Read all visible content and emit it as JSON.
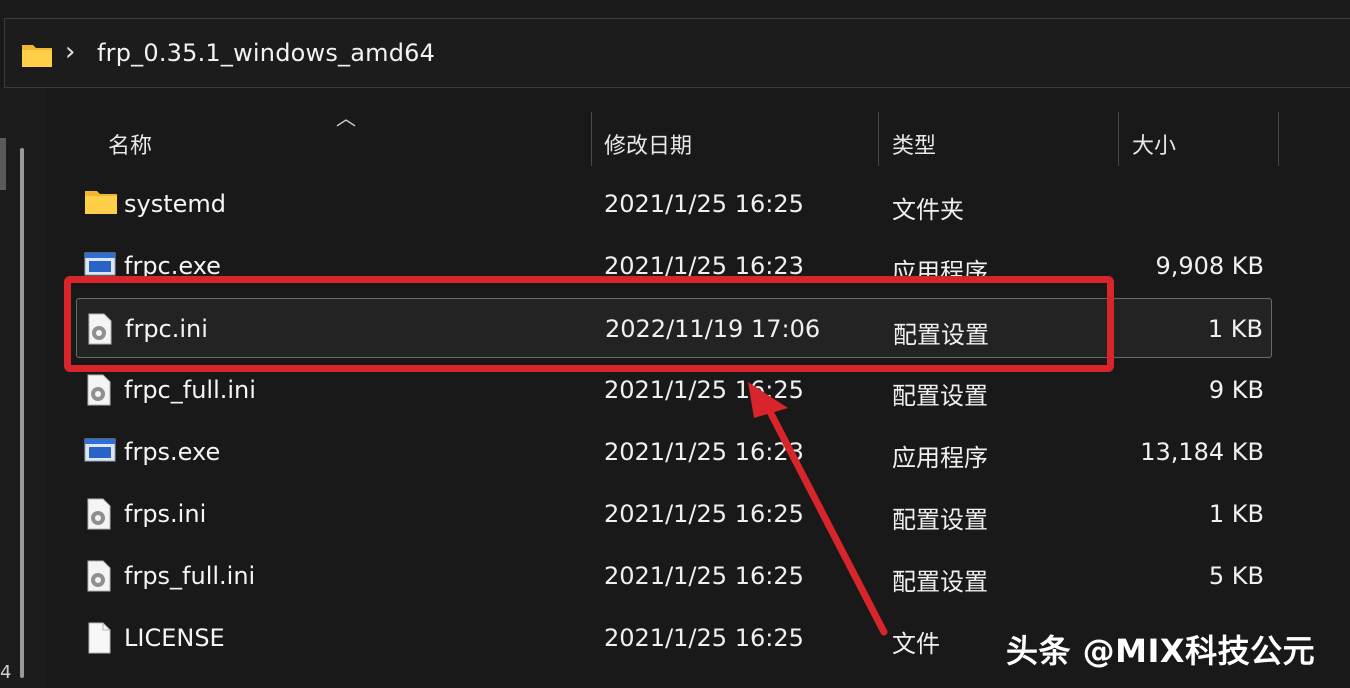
{
  "address": {
    "path": "frp_0.35.1_windows_amd64"
  },
  "columns": {
    "name": "名称",
    "date": "修改日期",
    "type": "类型",
    "size": "大小"
  },
  "files": [
    {
      "icon": "folder-icon",
      "name": "systemd",
      "date": "2021/1/25 16:25",
      "type": "文件夹",
      "size": ""
    },
    {
      "icon": "exe-icon",
      "name": "frpc.exe",
      "date": "2021/1/25 16:23",
      "type": "应用程序",
      "size": "9,908 KB"
    },
    {
      "icon": "config-file-icon",
      "name": "frpc.ini",
      "date": "2022/11/19 17:06",
      "type": "配置设置",
      "size": "1 KB",
      "selected": true
    },
    {
      "icon": "config-file-icon",
      "name": "frpc_full.ini",
      "date": "2021/1/25 16:25",
      "type": "配置设置",
      "size": "9 KB"
    },
    {
      "icon": "exe-icon",
      "name": "frps.exe",
      "date": "2021/1/25 16:23",
      "type": "应用程序",
      "size": "13,184 KB"
    },
    {
      "icon": "config-file-icon",
      "name": "frps.ini",
      "date": "2021/1/25 16:25",
      "type": "配置设置",
      "size": "1 KB"
    },
    {
      "icon": "config-file-icon",
      "name": "frps_full.ini",
      "date": "2021/1/25 16:25",
      "type": "配置设置",
      "size": "5 KB"
    },
    {
      "icon": "file-icon",
      "name": "LICENSE",
      "date": "2021/1/25 16:25",
      "type": "文件",
      "size": ""
    }
  ],
  "left_pane": {
    "digit": "4"
  },
  "watermark": "头条 @MIX科技公元",
  "colors": {
    "highlight": "#d8242b",
    "background": "#191919"
  }
}
